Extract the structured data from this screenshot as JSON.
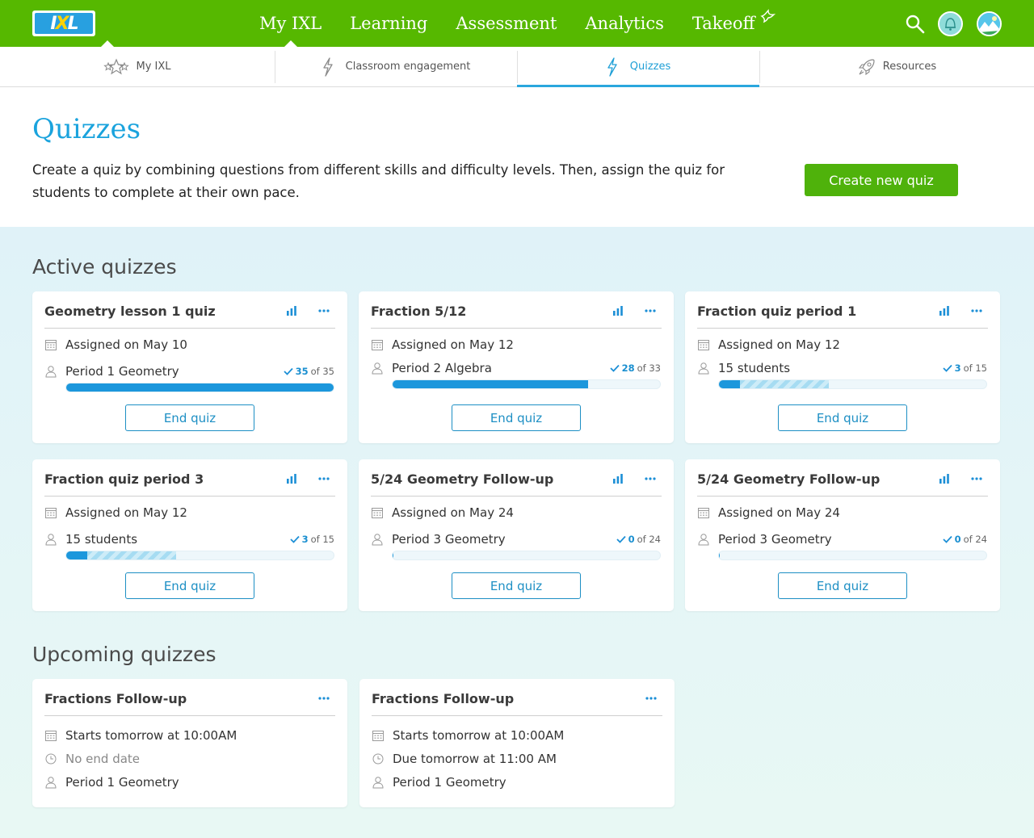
{
  "topnav": {
    "logo_text": "IXL",
    "items": [
      {
        "label": "My IXL",
        "active": true
      },
      {
        "label": "Learning"
      },
      {
        "label": "Assessment"
      },
      {
        "label": "Analytics"
      },
      {
        "label": "Takeoff"
      }
    ]
  },
  "subnav": {
    "items": [
      {
        "label": "My IXL",
        "icon": "stars-icon"
      },
      {
        "label": "Classroom engagement",
        "icon": "lightning-icon"
      },
      {
        "label": "Quizzes",
        "icon": "lightning-icon",
        "active": true
      },
      {
        "label": "Resources",
        "icon": "rocket-icon"
      }
    ]
  },
  "header": {
    "title": "Quizzes",
    "description": "Create a quiz by combining questions from different skills and difficulty levels. Then, assign the quiz for students to complete at their own pace.",
    "create_button": "Create new quiz"
  },
  "active": {
    "title": "Active quizzes",
    "cards": [
      {
        "title": "Geometry lesson 1 quiz",
        "assigned": "Assigned on May 10",
        "group": "Period 1 Geometry",
        "done": "35",
        "of": "of 35",
        "progress": 1.0,
        "partial": 0,
        "end_label": "End quiz"
      },
      {
        "title": "Fraction 5/12",
        "assigned": "Assigned on May 12",
        "group": "Period 2 Algebra",
        "done": "28",
        "of": "of 33",
        "progress": 0.73,
        "partial": 0,
        "end_label": "End quiz"
      },
      {
        "title": "Fraction quiz period 1",
        "assigned": "Assigned on May 12",
        "group": "15 students",
        "done": "3",
        "of": "of 15",
        "progress": 0.08,
        "partial": 0.41,
        "end_label": "End quiz"
      },
      {
        "title": "Fraction quiz period 3",
        "assigned": "Assigned on May 12",
        "group": "15 students",
        "done": "3",
        "of": "of 15",
        "progress": 0.08,
        "partial": 0.41,
        "end_label": "End quiz"
      },
      {
        "title": "5/24 Geometry Follow-up",
        "assigned": "Assigned on May 24",
        "group": "Period 3 Geometry",
        "done": "0",
        "of": "of 24",
        "progress": 0,
        "partial": 0,
        "end_label": "End quiz"
      },
      {
        "title": "5/24 Geometry Follow-up",
        "assigned": "Assigned on May 24",
        "group": "Period 3 Geometry",
        "done": "0",
        "of": "of 24",
        "progress": 0,
        "partial": 0,
        "end_label": "End quiz"
      }
    ]
  },
  "upcoming": {
    "title": "Upcoming quizzes",
    "cards": [
      {
        "title": "Fractions Follow-up",
        "starts": "Starts tomorrow at 10:00AM",
        "due": "No end date",
        "group": "Period 1 Geometry"
      },
      {
        "title": "Fractions Follow-up",
        "starts": "Starts tomorrow at 10:00AM",
        "due": "Due tomorrow at 11:00 AM",
        "group": "Period 1 Geometry"
      }
    ]
  },
  "colors": {
    "brand_green": "#56b800",
    "accent_blue": "#1aa3dd",
    "progress_blue": "#1c97dc"
  }
}
